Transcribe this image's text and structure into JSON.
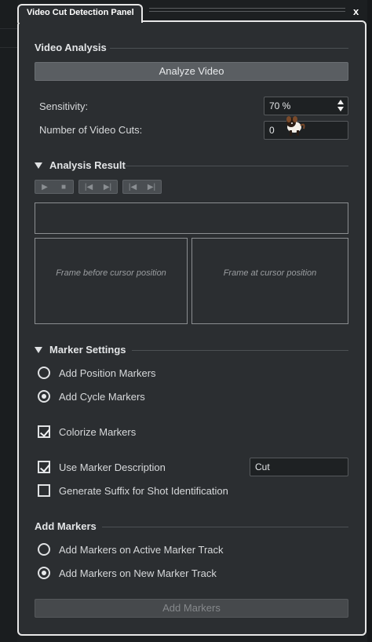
{
  "window": {
    "tab_title": "Video Cut Detection Panel",
    "close_label": "x"
  },
  "video_analysis": {
    "heading": "Video Analysis",
    "analyze_label": "Analyze Video",
    "sensitivity_label": "Sensitivity:",
    "sensitivity_value": "70 %",
    "cuts_label": "Number of Video Cuts:",
    "cuts_value": "0"
  },
  "analysis_result": {
    "heading": "Analysis Result",
    "transport_icons": [
      "play-icon",
      "stop-icon",
      "previous-icon",
      "next-icon",
      "previous-marker-icon",
      "next-marker-icon"
    ],
    "frame_before_label": "Frame before cursor position",
    "frame_at_label": "Frame at cursor position"
  },
  "marker_settings": {
    "heading": "Marker Settings",
    "position_markers_label": "Add Position Markers",
    "cycle_markers_label": "Add Cycle Markers",
    "selected_marker_type": "cycle",
    "colorize_label": "Colorize Markers",
    "colorize_checked": true,
    "use_description_label": "Use Marker Description",
    "use_description_checked": true,
    "description_value": "Cut",
    "suffix_label": "Generate Suffix for Shot Identification",
    "suffix_checked": false
  },
  "add_markers": {
    "heading": "Add Markers",
    "active_track_label": "Add Markers on Active Marker Track",
    "new_track_label": "Add Markers on New Marker Track",
    "selected_track": "new",
    "button_label": "Add Markers"
  },
  "colors": {
    "panel_bg": "#2b2e31",
    "panel_border": "#e8e8e8",
    "button_bg": "#5a5e62",
    "field_bg": "#1e2123"
  }
}
